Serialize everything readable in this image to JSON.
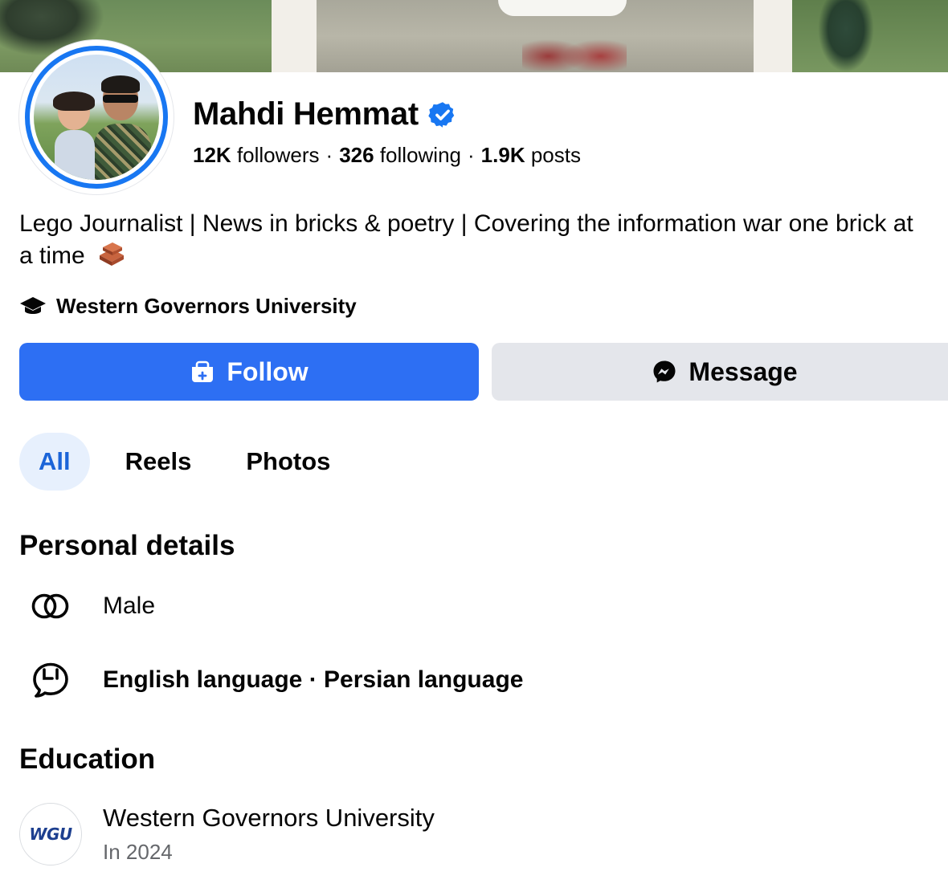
{
  "profile": {
    "name": "Mahdi Hemmat",
    "verified_icon": "verified-badge-icon",
    "followers_count": "12K",
    "followers_label": "followers",
    "following_count": "326",
    "following_label": "following",
    "posts_count": "1.9K",
    "posts_label": "posts",
    "separator": "·",
    "bio": "Lego Journalist | News in bricks & poetry | Covering the information war one brick at a time",
    "education_line": "Western Governors University"
  },
  "actions": {
    "follow_label": "Follow",
    "message_label": "Message"
  },
  "tabs": [
    {
      "label": "All",
      "active": true
    },
    {
      "label": "Reels",
      "active": false
    },
    {
      "label": "Photos",
      "active": false
    }
  ],
  "personal_details": {
    "title": "Personal details",
    "gender": "Male",
    "languages": "English language · Persian language"
  },
  "education": {
    "title": "Education",
    "school": "Western Governors University",
    "year": "In 2024",
    "logo_text": "WGU"
  },
  "colors": {
    "accent": "#2d6ff3",
    "active_tab_bg": "#e7f0fd",
    "secondary_button": "#e4e6eb",
    "muted_text": "#65676b"
  }
}
